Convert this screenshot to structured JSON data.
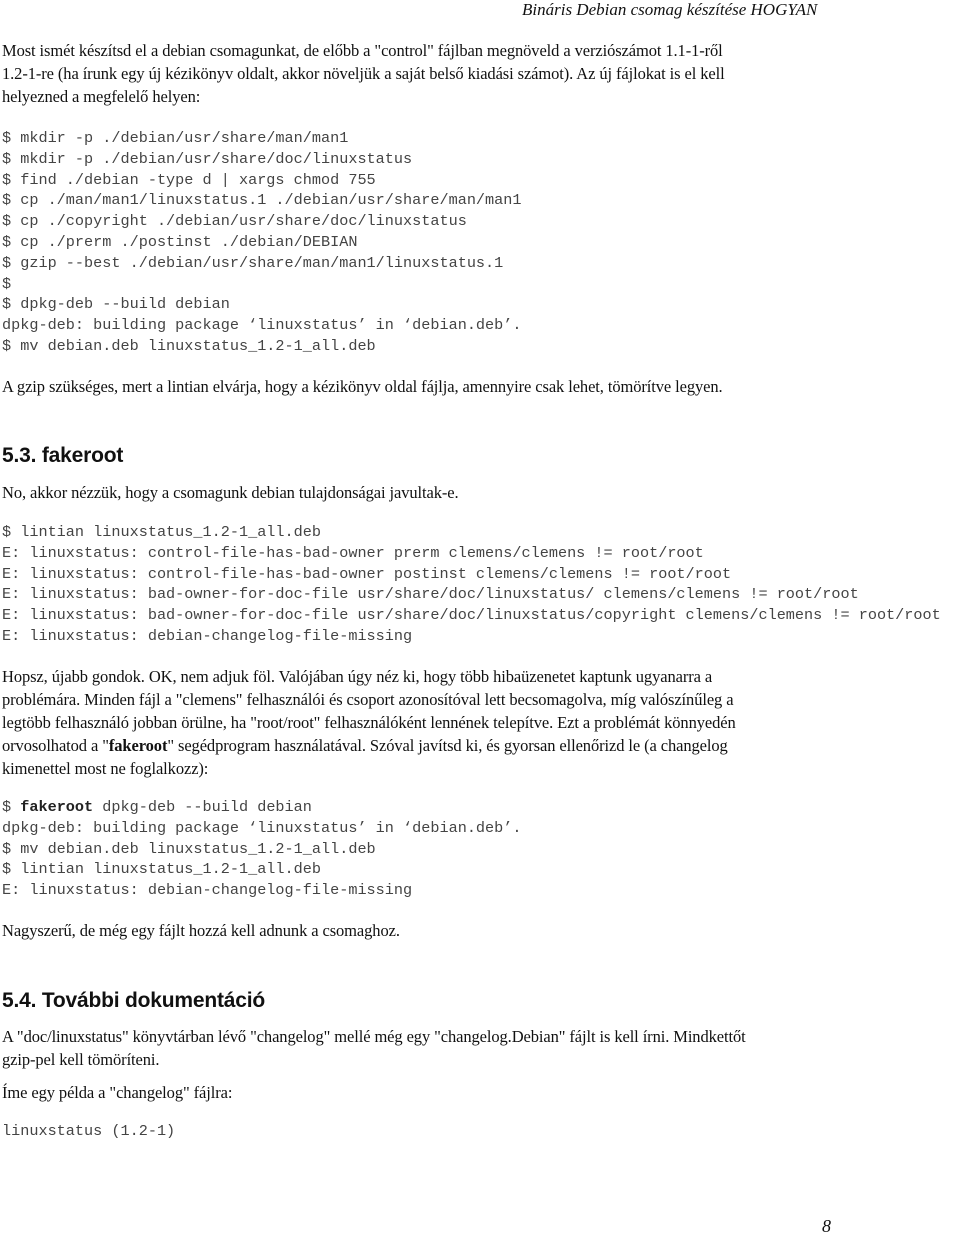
{
  "header": {
    "title": "Bináris Debian csomag készítése HOGYAN"
  },
  "intro": {
    "lines": [
      "Most ismét készítsd el a debian csomagunkat, de előbb a \"control\" fájlban megnöveld a verziószámot 1.1-1-ről",
      "1.2-1-re (ha írunk egy új kézikönyv oldalt, akkor növeljük a saját belső kiadási számot). Az új fájlokat is el kell",
      "helyezned a megfelelő helyen:"
    ]
  },
  "code1": {
    "lines": [
      "$ mkdir -p ./debian/usr/share/man/man1",
      "$ mkdir -p ./debian/usr/share/doc/linuxstatus",
      "$ find ./debian -type d | xargs chmod 755",
      "$ cp ./man/man1/linuxstatus.1 ./debian/usr/share/man/man1",
      "$ cp ./copyright ./debian/usr/share/doc/linuxstatus",
      "$ cp ./prerm ./postinst ./debian/DEBIAN",
      "$ gzip --best ./debian/usr/share/man/man1/linuxstatus.1",
      "$",
      "$ dpkg-deb --build debian",
      "dpkg-deb: building package ‘linuxstatus’ in ‘debian.deb’.",
      "$ mv debian.deb linuxstatus_1.2-1_all.deb"
    ]
  },
  "gzip_note": "A gzip szükséges, mert a lintian elvárja, hogy a kézikönyv oldal fájlja, amennyire csak lehet, tömörítve legyen.",
  "section_53": {
    "heading": "5.3. fakeroot",
    "intro": "No, akkor nézzük, hogy a csomagunk debian tulajdonságai javultak-e."
  },
  "code2": {
    "lines": [
      "$ lintian linuxstatus_1.2-1_all.deb",
      "E: linuxstatus: control-file-has-bad-owner prerm clemens/clemens != root/root",
      "E: linuxstatus: control-file-has-bad-owner postinst clemens/clemens != root/root",
      "E: linuxstatus: bad-owner-for-doc-file usr/share/doc/linuxstatus/ clemens/clemens != root/root",
      "E: linuxstatus: bad-owner-for-doc-file usr/share/doc/linuxstatus/copyright clemens/clemens != root/root",
      "E: linuxstatus: debian-changelog-file-missing"
    ]
  },
  "hopsz": {
    "line1": "Hopsz, újabb gondok. OK, nem adjuk föl. Valójában úgy néz ki, hogy több hibaüzenetet kaptunk ugyanarra a",
    "line2": "problémára. Minden fájl a \"clemens\" felhasználói és csoport azonosítóval lett becsomagolva, míg valószínűleg a",
    "line3": "legtöbb felhasználó jobban örülne, ha \"root/root\" felhasználóként lennének telepítve. Ezt a problémát könnyedén",
    "line4_pre": "orvosolhatod a \"",
    "line4_bold": "fakeroot",
    "line4_post": "\" segédprogram használatával. Szóval javítsd ki, és gyorsan ellenőrizd le (a changelog",
    "line5": "kimenettel most ne foglalkozz):"
  },
  "code3": {
    "line1_prompt": "$ ",
    "line1_bold": "fakeroot",
    "line1_rest": " dpkg-deb --build debian",
    "lines": [
      "dpkg-deb: building package ‘linuxstatus’ in ‘debian.deb’.",
      "$ mv debian.deb linuxstatus_1.2-1_all.deb",
      "$ lintian linuxstatus_1.2-1_all.deb",
      "E: linuxstatus: debian-changelog-file-missing"
    ]
  },
  "great_note": "Nagyszerű, de még egy fájlt hozzá kell adnunk a csomaghoz.",
  "section_54": {
    "heading": "5.4. További dokumentáció",
    "para_line1": "A \"doc/linuxstatus\" könyvtárban lévő \"changelog\" mellé még egy \"changelog.Debian\" fájlt is kell írni. Mindkettőt",
    "para_line2": "gzip-pel kell tömöríteni.",
    "example_intro": "Íme egy példa a \"changelog\" fájlra:",
    "code_line": "linuxstatus (1.2-1)"
  },
  "footer": {
    "page_number": "8"
  }
}
